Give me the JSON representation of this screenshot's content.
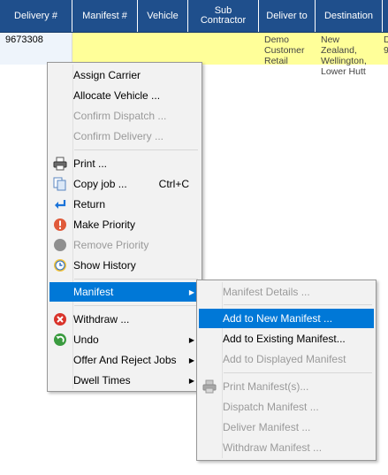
{
  "grid": {
    "headers": [
      "Delivery #",
      "Manifest #",
      "Vehicle",
      "Sub Contractor",
      "Deliver to",
      "Destination"
    ],
    "row": {
      "delivery": "9673308",
      "deliver_to": "Demo Customer Retail",
      "destination": "New Zealand, Wellington, Lower Hutt",
      "overflow_1": "D",
      "overflow_2": "9"
    }
  },
  "context_menu": {
    "items": [
      {
        "label": "Assign Carrier"
      },
      {
        "label": "Allocate Vehicle ..."
      },
      {
        "label": "Confirm Dispatch ..."
      },
      {
        "label": "Confirm Delivery ..."
      },
      {
        "label": "Print ...",
        "icon": "printer-icon"
      },
      {
        "label": "Copy job ...",
        "shortcut": "Ctrl+C",
        "icon": "copy-icon"
      },
      {
        "label": "Return",
        "icon": "return-arrow-icon"
      },
      {
        "label": "Make Priority",
        "icon": "priority-alert-icon"
      },
      {
        "label": "Remove Priority",
        "icon": "priority-off-icon"
      },
      {
        "label": "Show History",
        "icon": "clock-history-icon"
      },
      {
        "label": "Manifest"
      },
      {
        "label": "Withdraw ...",
        "icon": "withdraw-x-icon"
      },
      {
        "label": "Undo",
        "icon": "undo-icon"
      },
      {
        "label": "Offer And Reject Jobs"
      },
      {
        "label": "Dwell Times"
      }
    ]
  },
  "manifest_submenu": {
    "items": [
      {
        "label": "Manifest Details ..."
      },
      {
        "label": "Add to New Manifest ..."
      },
      {
        "label": "Add to Existing Manifest..."
      },
      {
        "label": "Add to Displayed Manifest"
      },
      {
        "label": "Print Manifest(s)...",
        "icon": "printer-gray-icon"
      },
      {
        "label": "Dispatch Manifest ..."
      },
      {
        "label": "Deliver Manifest ..."
      },
      {
        "label": "Withdraw Manifest ..."
      }
    ]
  },
  "colors": {
    "header_bg": "#1f4f8c",
    "row_highlight": "#ffff99",
    "menu_bg": "#f2f2f2",
    "selection": "#0078d7",
    "disabled_text": "#9a9a9a"
  }
}
